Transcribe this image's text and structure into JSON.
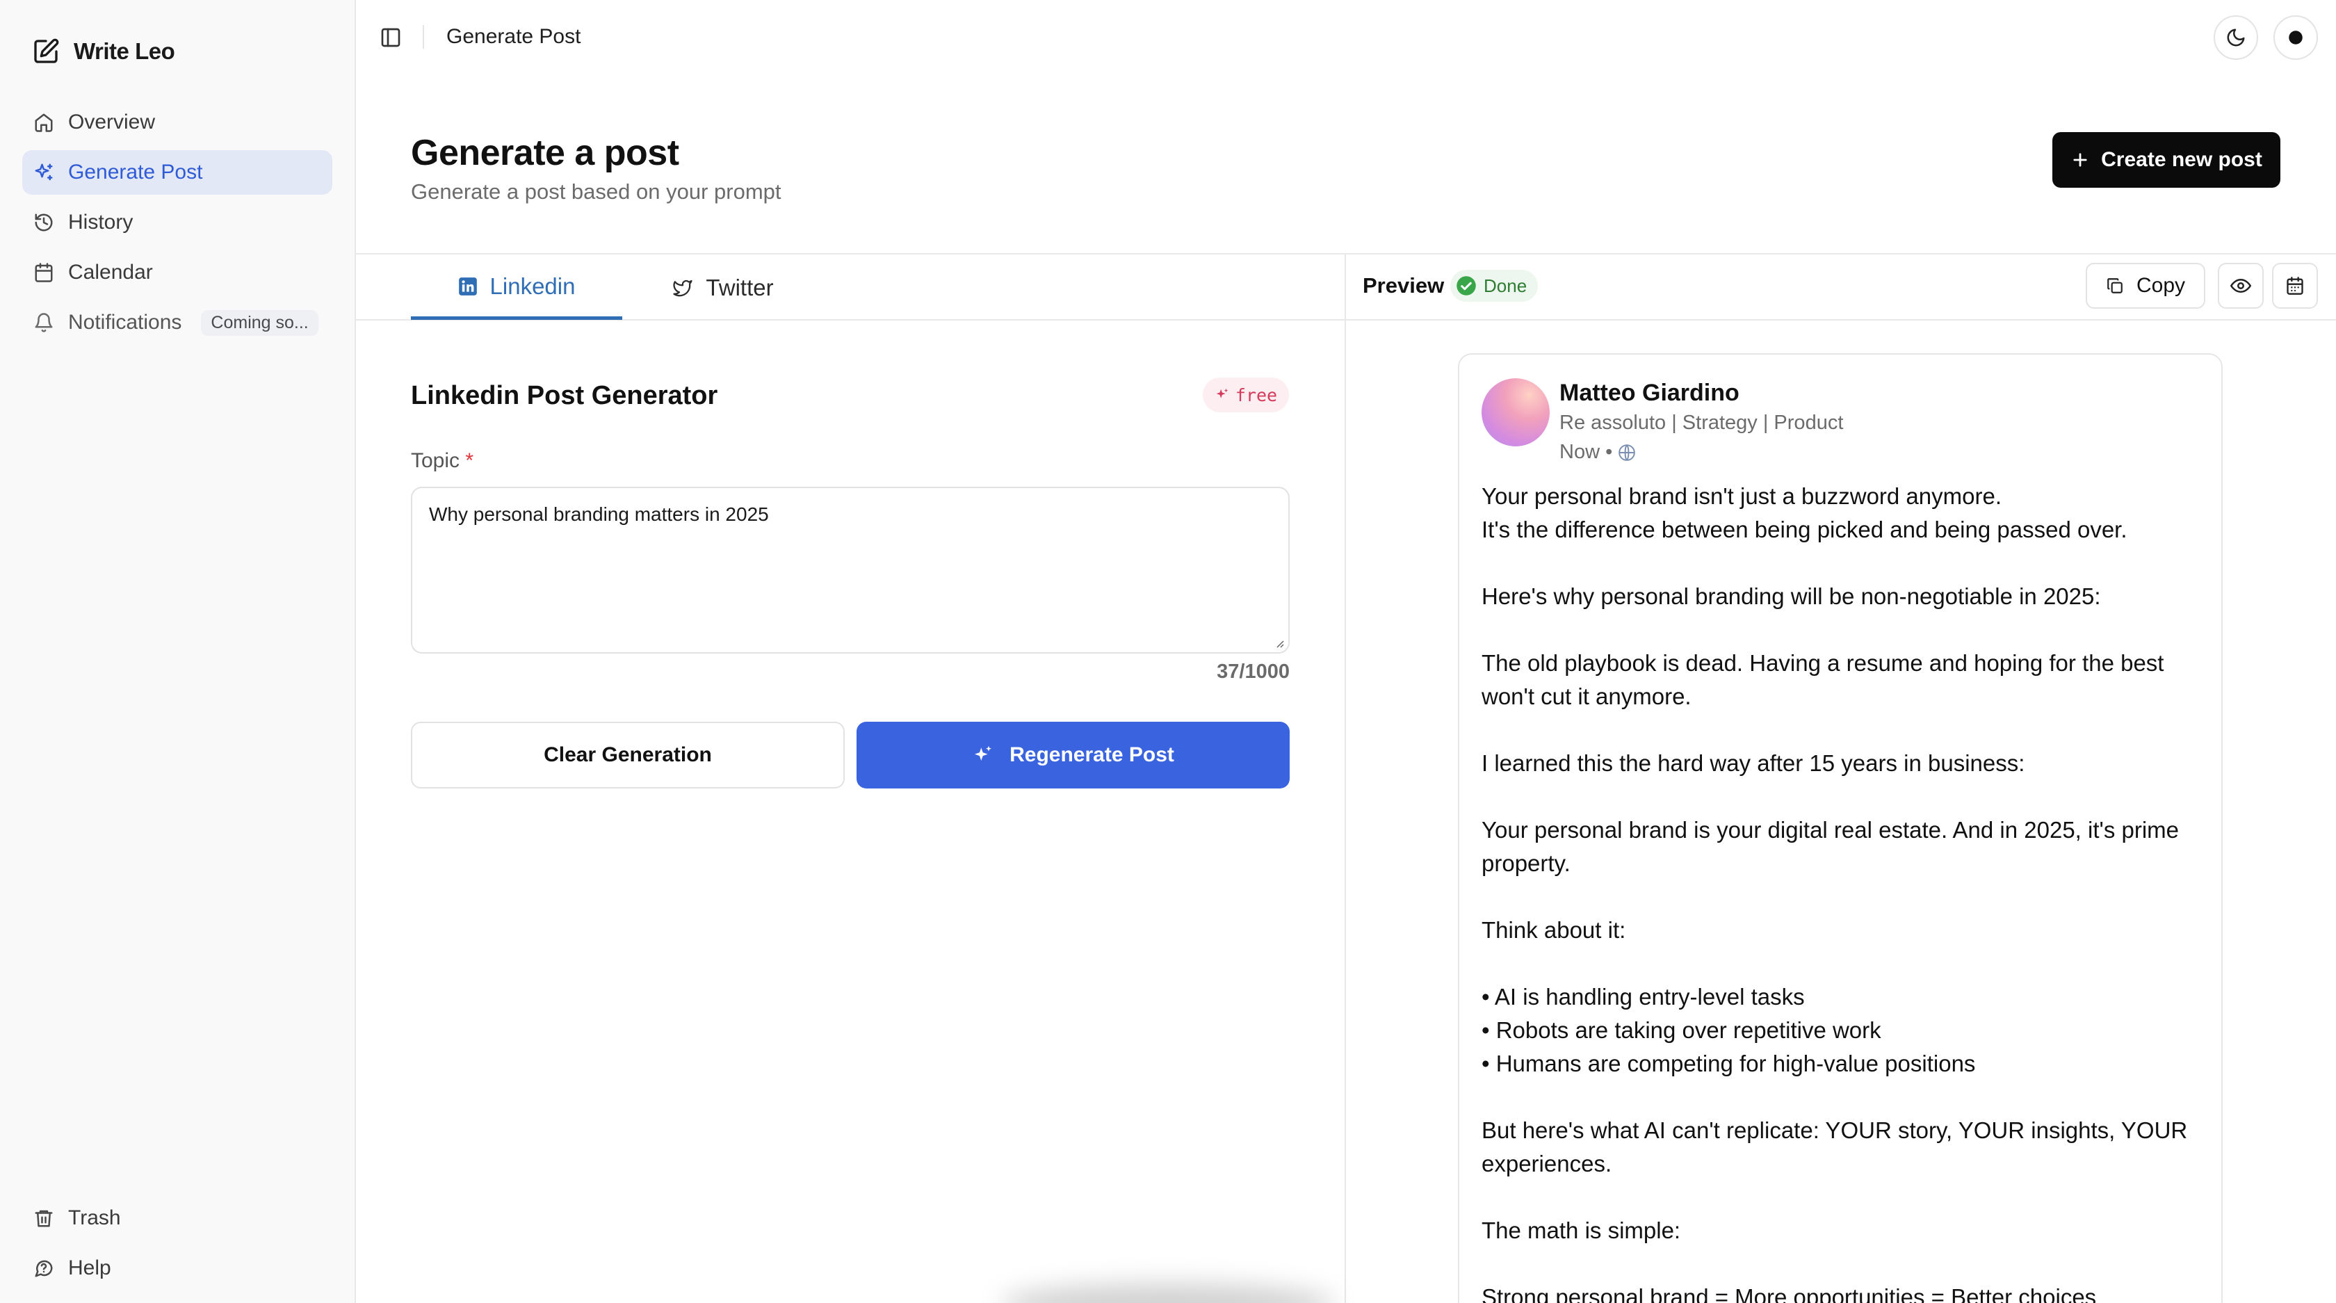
{
  "app": {
    "name": "Write Leo"
  },
  "sidebar": {
    "items": [
      {
        "label": "Overview"
      },
      {
        "label": "Generate Post"
      },
      {
        "label": "History"
      },
      {
        "label": "Calendar"
      },
      {
        "label": "Notifications",
        "badge": "Coming so..."
      }
    ],
    "bottom": [
      {
        "label": "Trash"
      },
      {
        "label": "Help"
      }
    ]
  },
  "topbar": {
    "title": "Generate Post"
  },
  "header": {
    "title": "Generate a post",
    "subtitle": "Generate a post based on your prompt",
    "create_button": "Create new post"
  },
  "tabs": [
    {
      "label": "Linkedin",
      "active": true
    },
    {
      "label": "Twitter",
      "active": false
    }
  ],
  "generator": {
    "title": "Linkedin Post Generator",
    "badge": "free",
    "topic_label": "Topic",
    "required_mark": "*",
    "topic_value": "Why personal branding matters in 2025",
    "char_count": "37/1000",
    "clear_button": "Clear Generation",
    "regenerate_button": "Regenerate Post"
  },
  "preview": {
    "label": "Preview",
    "status": "Done",
    "copy_button": "Copy",
    "post": {
      "author": "Matteo Giardino",
      "headline": "Re assoluto | Strategy | Product",
      "time": "Now •",
      "paragraphs": [
        [
          "Your personal brand isn't just a buzzword anymore.",
          "It's the difference between being picked and being passed over."
        ],
        [
          "Here's why personal branding will be non-negotiable in 2025:"
        ],
        [
          "The old playbook is dead. Having a resume and hoping for the best won't cut it anymore."
        ],
        [
          "I learned this the hard way after 15 years in business:"
        ],
        [
          "Your personal brand is your digital real estate. And in 2025, it's prime property."
        ],
        [
          "Think about it:"
        ],
        [
          "• AI is handling entry-level tasks",
          "• Robots are taking over repetitive work",
          "• Humans are competing for high-value positions"
        ],
        [
          "But here's what AI can't replicate: YOUR story, YOUR insights, YOUR experiences."
        ],
        [
          "The math is simple:"
        ],
        [
          "Strong personal brand = More opportunities = Better choices"
        ]
      ]
    }
  },
  "colors": {
    "accent": "#3a63e0",
    "active_nav_bg": "#e3e8f6",
    "linkedin_blue": "#2f6db5",
    "free_badge": "#d43a5c",
    "done_green": "#2e7d32"
  },
  "icons": {
    "brand": "edit-icon",
    "overview": "home-icon",
    "generate": "sparkles-icon",
    "history": "history-icon",
    "calendar": "calendar-icon",
    "notifications": "bell-icon",
    "trash": "trash-icon",
    "help": "help-icon",
    "theme": "moon-icon",
    "record": "record-icon",
    "copy": "copy-icon",
    "eye": "eye-icon",
    "schedule": "calendar-icon"
  }
}
